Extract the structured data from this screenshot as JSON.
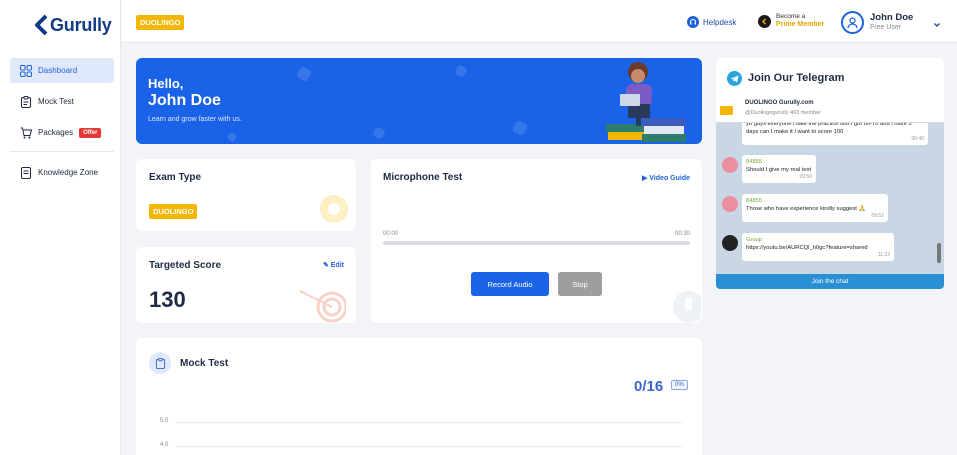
{
  "brand": {
    "name": "Gurully"
  },
  "sidebar": {
    "items": [
      {
        "label": "Dashboard",
        "icon": "dashboard-icon",
        "active": true
      },
      {
        "label": "Mock Test",
        "icon": "clipboard-icon"
      },
      {
        "label": "Packages",
        "icon": "cart-icon",
        "badge": "Offer"
      },
      {
        "label": "Knowledge Zone",
        "icon": "book-icon"
      }
    ]
  },
  "topbar": {
    "exam": "DUOLINGO",
    "helpdesk": "Helpdesk",
    "prime_line1": "Become a",
    "prime_line2": "Prime Member",
    "user_name": "John Doe",
    "user_role": "Free User"
  },
  "hero": {
    "greeting": "Hello,",
    "name": "John Doe",
    "subtitle": "Learn and grow faster with us."
  },
  "exam_type": {
    "title": "Exam Type",
    "value": "DUOLINGO"
  },
  "targeted_score": {
    "title": "Targeted Score",
    "edit": "Edit",
    "value": "130"
  },
  "microphone": {
    "title": "Microphone Test",
    "video_guide": "Video Guide",
    "time_start": "00:00",
    "time_end": "00:30",
    "progress": 0,
    "record_label": "Record Audio",
    "stop_label": "Stop"
  },
  "mock_test": {
    "title": "Mock Test",
    "count": "0/16",
    "percent": "0%",
    "y_ticks": [
      "5.0",
      "4.0"
    ]
  },
  "telegram": {
    "title": "Join Our Telegram",
    "channel": "DUOLINGO Gurully.com",
    "channel_sub": "@Duolingogurully 463 member",
    "messages": [
      {
        "author": "",
        "text": "yo guys everyone i take the practice test i got 60-70 and i have 3 days can I make it I want to score 100",
        "time": "00:46"
      },
      {
        "author": "84855 .",
        "text": "Should I give my real test",
        "time": "09:50"
      },
      {
        "author": "84855 .",
        "text": "Those who have experience kindly suggest 🙏",
        "time": "09:52"
      },
      {
        "author": "Group",
        "text": "https://youtu.be/AURCQl_h0gc?feature=shared",
        "time": "11:22"
      }
    ],
    "join_label": "Join the chat"
  },
  "colors": {
    "primary": "#1a63e8",
    "accent": "#f2b705",
    "offer": "#e53935",
    "telegram": "#2aa3df"
  }
}
